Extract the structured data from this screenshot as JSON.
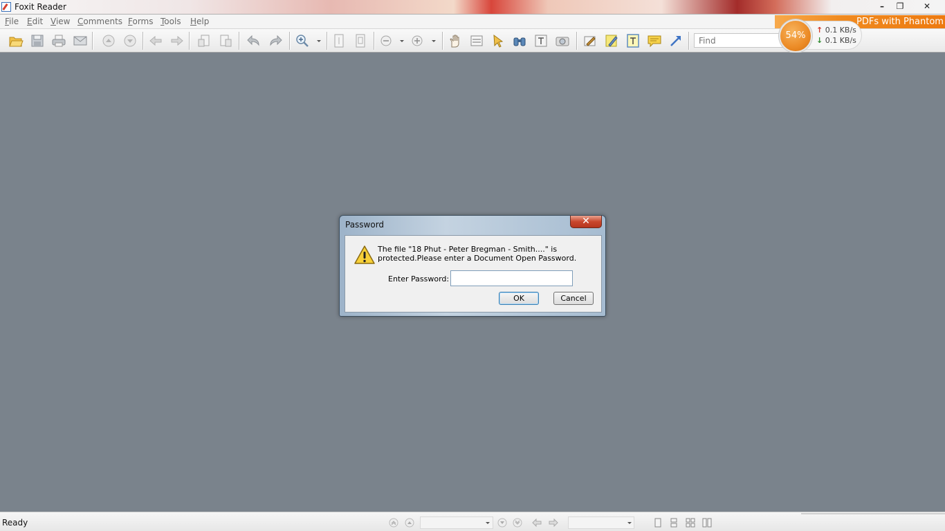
{
  "window": {
    "title": "Foxit Reader",
    "minimize": "–",
    "restore": "❐",
    "close": "✕"
  },
  "menu": {
    "items": [
      {
        "first": "F",
        "rest": "ile"
      },
      {
        "first": "E",
        "rest": "dit"
      },
      {
        "first": "V",
        "rest": "iew"
      },
      {
        "first": "C",
        "rest": "omments"
      },
      {
        "first": "F",
        "rest": "orms"
      },
      {
        "first": "T",
        "rest": "ools"
      },
      {
        "first": "H",
        "rest": "elp"
      }
    ]
  },
  "promo": {
    "text": "PDFs with Phantom"
  },
  "toolbar": {
    "find_placeholder": "Find"
  },
  "network": {
    "percent": "54%",
    "upload": "0.1 KB/s",
    "download": "0.1 KB/s",
    "up_arrow": "↑",
    "down_arrow": "↓"
  },
  "dialog": {
    "title": "Password",
    "close": "✕",
    "message_line1": "The file \"18 Phut - Peter Bregman - Smith....\" is",
    "message_line2": "protected.Please enter a Document Open Password.",
    "password_label": "Enter Password:",
    "password_value": "",
    "ok_label": "OK",
    "cancel_label": "Cancel"
  },
  "status": {
    "text": "Ready"
  },
  "colors": {
    "workspace": "#7a838c",
    "accent_orange": "#ec8b26",
    "close_red": "#c9472d"
  }
}
